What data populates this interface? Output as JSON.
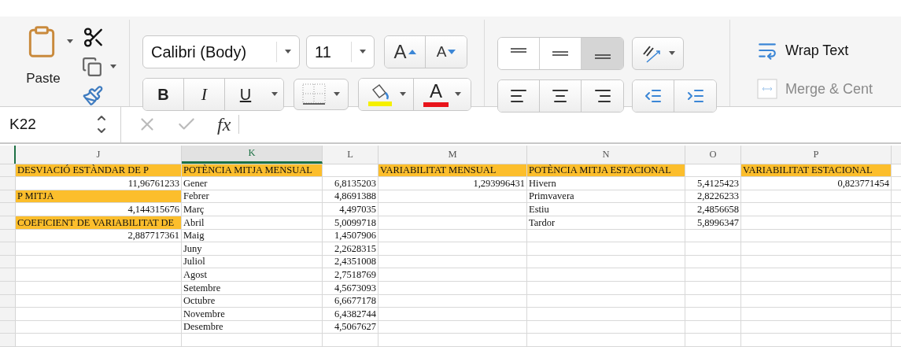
{
  "ribbon": {
    "paste_label": "Paste",
    "font_name": "Calibri (Body)",
    "font_size": "11",
    "grow_font": "A",
    "shrink_font": "A",
    "bold": "B",
    "italic": "I",
    "underline": "U",
    "font_color": "A",
    "vertical_align": [
      {
        "selected": false
      },
      {
        "selected": false
      },
      {
        "selected": true
      }
    ],
    "wrap_text": "Wrap Text",
    "merge_center": {
      "label": "Merge & Cent",
      "disabled": true
    }
  },
  "formula_bar": {
    "name_box": "K22",
    "fx": "fx"
  },
  "columns": [
    {
      "label": "J",
      "selected": false
    },
    {
      "label": "K",
      "selected": true
    },
    {
      "label": "L",
      "selected": false
    },
    {
      "label": "M",
      "selected": false
    },
    {
      "label": "N",
      "selected": false
    },
    {
      "label": "O",
      "selected": false
    },
    {
      "label": "P",
      "selected": false
    }
  ],
  "rows": [
    [
      {
        "text": "DESVIACIÓ ESTÀNDAR DE P",
        "kind": "text",
        "highlighted": true
      },
      {
        "text": "POTÈNCIA MITJA MENSUAL",
        "kind": "text",
        "highlighted": true
      },
      {
        "highlighted": false
      },
      {
        "text": "VARIABILITAT MENSUAL",
        "kind": "text",
        "highlighted": true
      },
      {
        "text": "POTÈNCIA MITJA ESTACIONAL",
        "kind": "text",
        "highlighted": true
      },
      {
        "highlighted": false
      },
      {
        "text": "VARIABILITAT ESTACIONAL",
        "kind": "text",
        "highlighted": true
      }
    ],
    [
      {
        "text": "11,96761233",
        "kind": "number",
        "highlighted": false
      },
      {
        "text": "Gener",
        "kind": "text",
        "highlighted": false
      },
      {
        "text": "6,8135203",
        "kind": "number",
        "highlighted": false
      },
      {
        "text": "1,293996431",
        "kind": "number",
        "highlighted": false
      },
      {
        "text": "Hivern",
        "kind": "text",
        "highlighted": false
      },
      {
        "text": "5,4125423",
        "kind": "number",
        "highlighted": false
      },
      {
        "text": "0,823771454",
        "kind": "number",
        "highlighted": false
      }
    ],
    [
      {
        "text": "P MITJA",
        "kind": "text",
        "highlighted": true
      },
      {
        "text": "Febrer",
        "kind": "text",
        "highlighted": false
      },
      {
        "text": "4,8691388",
        "kind": "number",
        "highlighted": false
      },
      {
        "highlighted": false
      },
      {
        "text": "Primvavera",
        "kind": "text",
        "highlighted": false
      },
      {
        "text": "2,8226233",
        "kind": "number",
        "highlighted": false
      },
      {
        "highlighted": false
      }
    ],
    [
      {
        "text": "4,144315676",
        "kind": "number",
        "highlighted": false
      },
      {
        "text": "Març",
        "kind": "text",
        "highlighted": false
      },
      {
        "text": "4,497035",
        "kind": "number",
        "highlighted": false
      },
      {
        "highlighted": false
      },
      {
        "text": "Estiu",
        "kind": "text",
        "highlighted": false
      },
      {
        "text": "2,4856658",
        "kind": "number",
        "highlighted": false
      },
      {
        "highlighted": false
      }
    ],
    [
      {
        "text": "COEFICIENT DE VARIABILITAT DE",
        "kind": "text",
        "highlighted": true
      },
      {
        "text": "Abril",
        "kind": "text",
        "highlighted": false
      },
      {
        "text": "5,0099718",
        "kind": "number",
        "highlighted": false
      },
      {
        "highlighted": false
      },
      {
        "text": "Tardor",
        "kind": "text",
        "highlighted": false
      },
      {
        "text": "5,8996347",
        "kind": "number",
        "highlighted": false
      },
      {
        "highlighted": false
      }
    ],
    [
      {
        "text": "2,887717361",
        "kind": "number",
        "highlighted": false
      },
      {
        "text": "Maig",
        "kind": "text",
        "highlighted": false
      },
      {
        "text": "1,4507906",
        "kind": "number",
        "highlighted": false
      },
      {
        "highlighted": false
      },
      {
        "highlighted": false
      },
      {
        "highlighted": false
      },
      {
        "highlighted": false
      }
    ],
    [
      {
        "highlighted": false
      },
      {
        "text": "Juny",
        "kind": "text",
        "highlighted": false
      },
      {
        "text": "2,2628315",
        "kind": "number",
        "highlighted": false
      },
      {
        "highlighted": false
      },
      {
        "highlighted": false
      },
      {
        "highlighted": false
      },
      {
        "highlighted": false
      }
    ],
    [
      {
        "highlighted": false
      },
      {
        "text": "Juliol",
        "kind": "text",
        "highlighted": false
      },
      {
        "text": "2,4351008",
        "kind": "number",
        "highlighted": false
      },
      {
        "highlighted": false
      },
      {
        "highlighted": false
      },
      {
        "highlighted": false
      },
      {
        "highlighted": false
      }
    ],
    [
      {
        "highlighted": false
      },
      {
        "text": "Agost",
        "kind": "text",
        "highlighted": false
      },
      {
        "text": "2,7518769",
        "kind": "number",
        "highlighted": false
      },
      {
        "highlighted": false
      },
      {
        "highlighted": false
      },
      {
        "highlighted": false
      },
      {
        "highlighted": false
      }
    ],
    [
      {
        "highlighted": false
      },
      {
        "text": "Setembre",
        "kind": "text",
        "highlighted": false
      },
      {
        "text": "4,5673093",
        "kind": "number",
        "highlighted": false
      },
      {
        "highlighted": false
      },
      {
        "highlighted": false
      },
      {
        "highlighted": false
      },
      {
        "highlighted": false
      }
    ],
    [
      {
        "highlighted": false
      },
      {
        "text": "Octubre",
        "kind": "text",
        "highlighted": false
      },
      {
        "text": "6,6677178",
        "kind": "number",
        "highlighted": false
      },
      {
        "highlighted": false
      },
      {
        "highlighted": false
      },
      {
        "highlighted": false
      },
      {
        "highlighted": false
      }
    ],
    [
      {
        "highlighted": false
      },
      {
        "text": "Novembre",
        "kind": "text",
        "highlighted": false
      },
      {
        "text": "6,4382744",
        "kind": "number",
        "highlighted": false
      },
      {
        "highlighted": false
      },
      {
        "highlighted": false
      },
      {
        "highlighted": false
      },
      {
        "highlighted": false
      }
    ],
    [
      {
        "highlighted": false
      },
      {
        "text": "Desembre",
        "kind": "text",
        "highlighted": false
      },
      {
        "text": "4,5067627",
        "kind": "number",
        "highlighted": false
      },
      {
        "highlighted": false
      },
      {
        "highlighted": false
      },
      {
        "highlighted": false
      },
      {
        "highlighted": false
      }
    ],
    [
      {
        "highlighted": false
      },
      {
        "highlighted": false
      },
      {
        "highlighted": false
      },
      {
        "highlighted": false
      },
      {
        "highlighted": false
      },
      {
        "highlighted": false
      },
      {
        "highlighted": false
      }
    ]
  ]
}
